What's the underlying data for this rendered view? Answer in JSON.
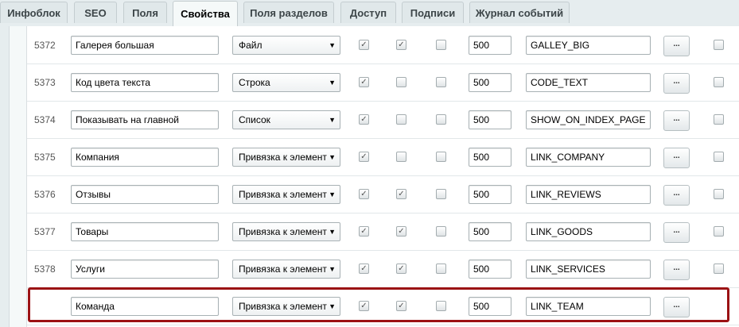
{
  "tabs": [
    {
      "label": "Инфоблок",
      "active": false
    },
    {
      "label": "SEO",
      "active": false
    },
    {
      "label": "Поля",
      "active": false
    },
    {
      "label": "Свойства",
      "active": true
    },
    {
      "label": "Поля разделов",
      "active": false
    },
    {
      "label": "Доступ",
      "active": false
    },
    {
      "label": "Подписи",
      "active": false
    },
    {
      "label": "Журнал событий",
      "active": false
    }
  ],
  "rows": [
    {
      "id": "5372",
      "name": "Галерея большая",
      "type": "Файл",
      "active": true,
      "multiple": true,
      "required": false,
      "sort": "500",
      "code": "GALLEY_BIG",
      "more_label": "...",
      "delete": false
    },
    {
      "id": "5373",
      "name": "Код цвета текста",
      "type": "Строка",
      "active": true,
      "multiple": false,
      "required": false,
      "sort": "500",
      "code": "CODE_TEXT",
      "more_label": "...",
      "delete": false
    },
    {
      "id": "5374",
      "name": "Показывать на главной",
      "type": "Список",
      "active": true,
      "multiple": false,
      "required": false,
      "sort": "500",
      "code": "SHOW_ON_INDEX_PAGE",
      "more_label": "...",
      "delete": false
    },
    {
      "id": "5375",
      "name": "Компания",
      "type": "Привязка к элемент",
      "active": true,
      "multiple": false,
      "required": false,
      "sort": "500",
      "code": "LINK_COMPANY",
      "more_label": "...",
      "delete": false
    },
    {
      "id": "5376",
      "name": "Отзывы",
      "type": "Привязка к элемент",
      "active": true,
      "multiple": true,
      "required": false,
      "sort": "500",
      "code": "LINK_REVIEWS",
      "more_label": "...",
      "delete": false
    },
    {
      "id": "5377",
      "name": "Товары",
      "type": "Привязка к элемент",
      "active": true,
      "multiple": true,
      "required": false,
      "sort": "500",
      "code": "LINK_GOODS",
      "more_label": "...",
      "delete": false
    },
    {
      "id": "5378",
      "name": "Услуги",
      "type": "Привязка к элемент",
      "active": true,
      "multiple": true,
      "required": false,
      "sort": "500",
      "code": "LINK_SERVICES",
      "more_label": "...",
      "delete": false
    },
    {
      "id": "",
      "name": "Команда",
      "type": "Привязка к элемент",
      "active": true,
      "multiple": true,
      "required": false,
      "sort": "500",
      "code": "LINK_TEAM",
      "more_label": "...",
      "delete": null,
      "highlighted": true
    }
  ],
  "colors": {
    "highlight": "#9b1214",
    "background": "#e6edef"
  }
}
